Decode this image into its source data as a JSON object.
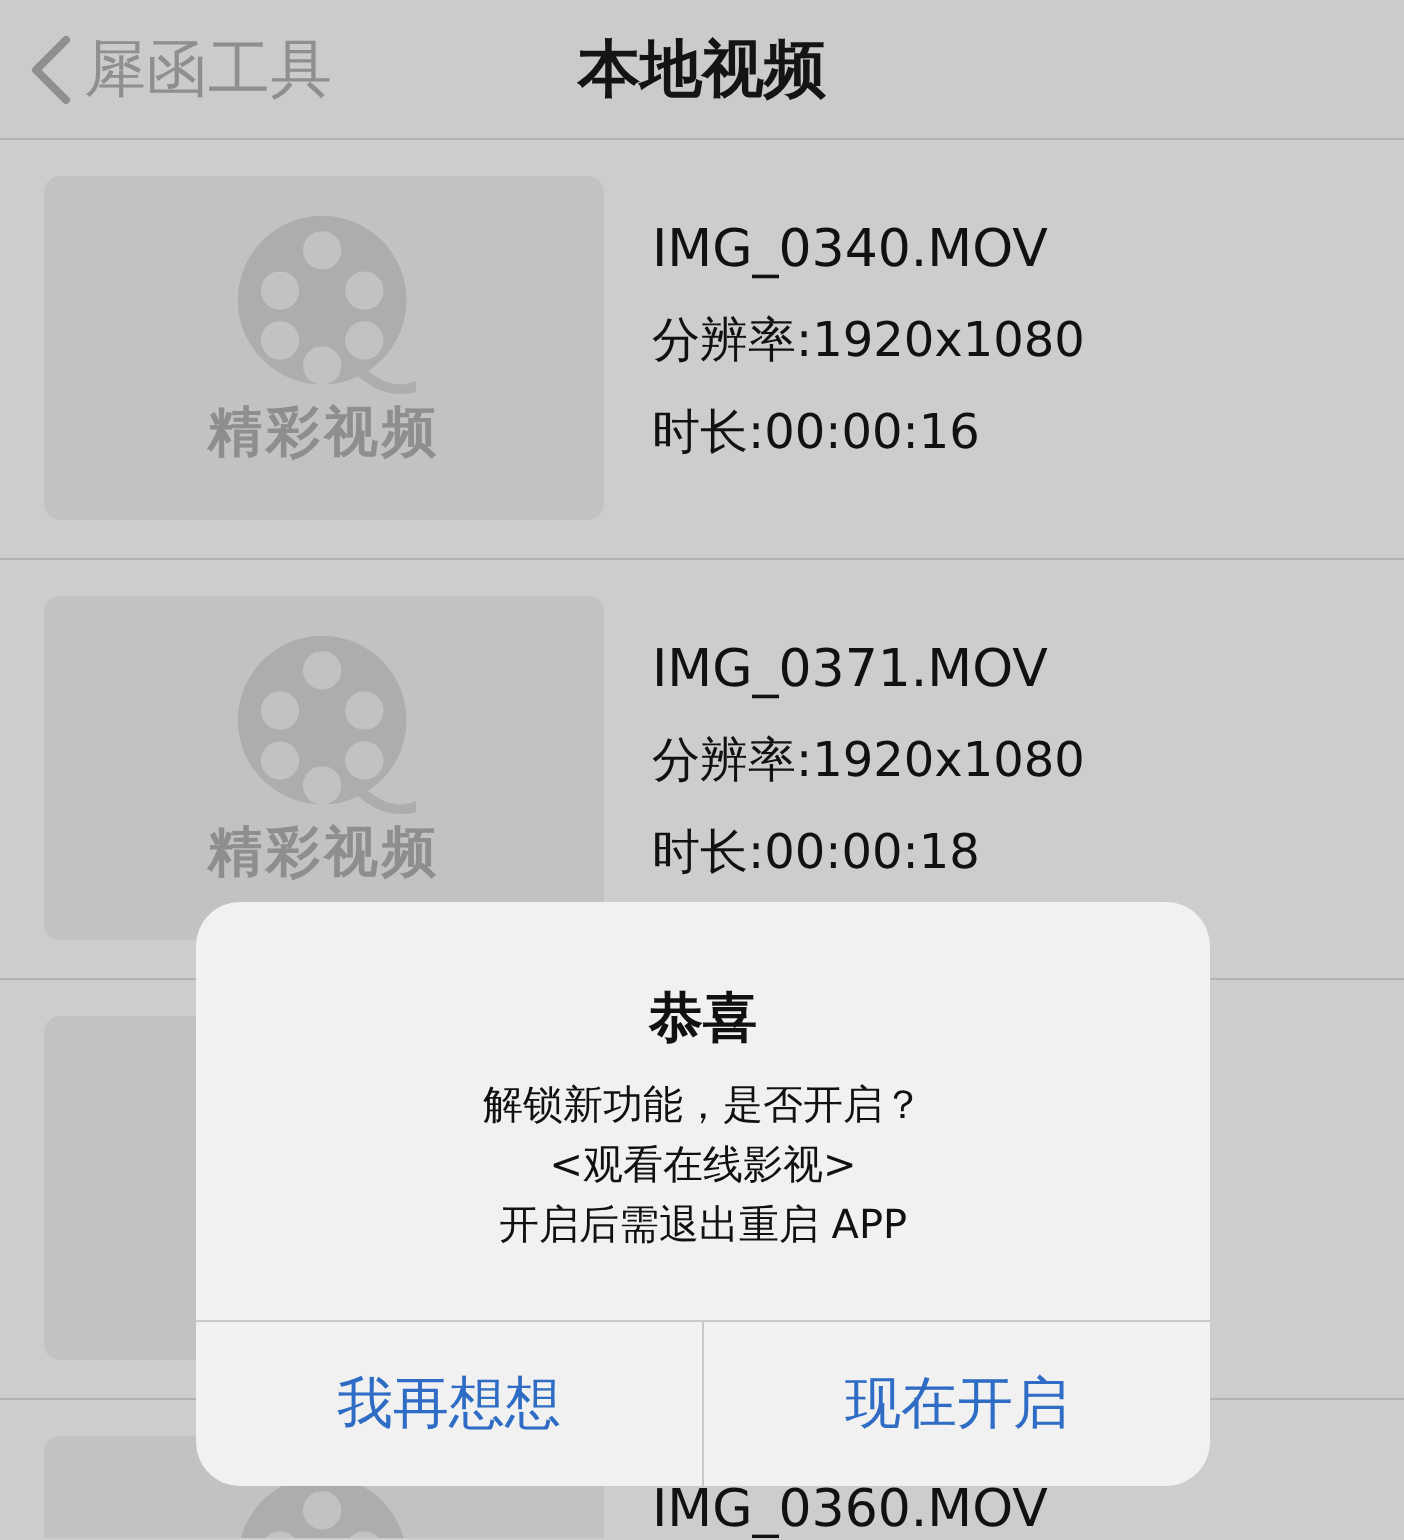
{
  "nav": {
    "back": "犀函工具",
    "title": "本地视频"
  },
  "videos": [
    {
      "kind": "video",
      "caption": "精彩视频",
      "name": "IMG_0340.MOV",
      "resolution": "分辨率:1920x1080",
      "duration": "时长:00:00:16"
    },
    {
      "kind": "video",
      "caption": "精彩视频",
      "name": "IMG_0371.MOV",
      "resolution": "分辨率:1920x1080",
      "duration": "时长:00:00:18"
    },
    {
      "kind": "video"
    },
    {
      "kind": "video",
      "name": "IMG_0360.MOV"
    }
  ],
  "dialog": {
    "title": "恭喜",
    "message": [
      "解锁新功能，是否开启？",
      "<观看在线影视>",
      "开启后需退出重启 APP"
    ],
    "buttons": [
      "我再想想",
      "现在开启"
    ]
  }
}
